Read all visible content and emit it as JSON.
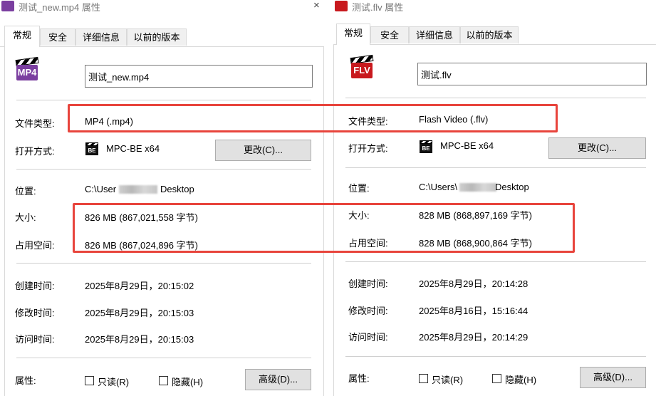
{
  "left": {
    "title": "测试_new.mp4 属性",
    "format_badge": "MP4",
    "tabs": [
      "常规",
      "安全",
      "详细信息",
      "以前的版本"
    ],
    "filename": "测试_new.mp4",
    "labels": {
      "type": "文件类型:",
      "opens_with": "打开方式:",
      "location": "位置:",
      "size": "大小:",
      "size_on_disk": "占用空间:",
      "created": "创建时间:",
      "modified": "修改时间:",
      "accessed": "访问时间:",
      "attributes": "属性:"
    },
    "file_type": "MP4 (.mp4)",
    "opens_with": "MPC-BE x64",
    "change_button": "更改(C)...",
    "location_prefix": "C:\\User",
    "location_suffix": "Desktop",
    "size": "826 MB (867,021,558 字节)",
    "size_on_disk": "826 MB (867,024,896 字节)",
    "created": "2025年8月29日，20:15:02",
    "modified": "2025年8月29日，20:15:03",
    "accessed": "2025年8月29日，20:15:03",
    "readonly_label": "只读(R)",
    "hidden_label": "隐藏(H)",
    "advanced_button": "高级(D)...",
    "close_glyph": "×"
  },
  "right": {
    "title": "测试.flv 属性",
    "format_badge": "FLV",
    "tabs": [
      "常规",
      "安全",
      "详细信息",
      "以前的版本"
    ],
    "filename": "测试.flv",
    "labels": {
      "type": "文件类型:",
      "opens_with": "打开方式:",
      "location": "位置:",
      "size": "大小:",
      "size_on_disk": "占用空间:",
      "created": "创建时间:",
      "modified": "修改时间:",
      "accessed": "访问时间:",
      "attributes": "属性:"
    },
    "file_type": "Flash Video (.flv)",
    "opens_with": "MPC-BE x64",
    "change_button": "更改(C)...",
    "location_prefix": "C:\\Users\\",
    "location_suffix": "Desktop",
    "size": "828 MB (868,897,169 字节)",
    "size_on_disk": "828 MB (868,900,864 字节)",
    "created": "2025年8月29日，20:14:28",
    "modified": "2025年8月16日，15:16:44",
    "accessed": "2025年8月29日，20:14:29",
    "readonly_label": "只读(R)",
    "hidden_label": "隐藏(H)",
    "advanced_button": "高级(D)..."
  },
  "icons": {
    "mpc_badge": "BE",
    "mp4_color": "#7b3fa0",
    "flv_color": "#c8191e",
    "highlight_color": "#e8443c"
  }
}
